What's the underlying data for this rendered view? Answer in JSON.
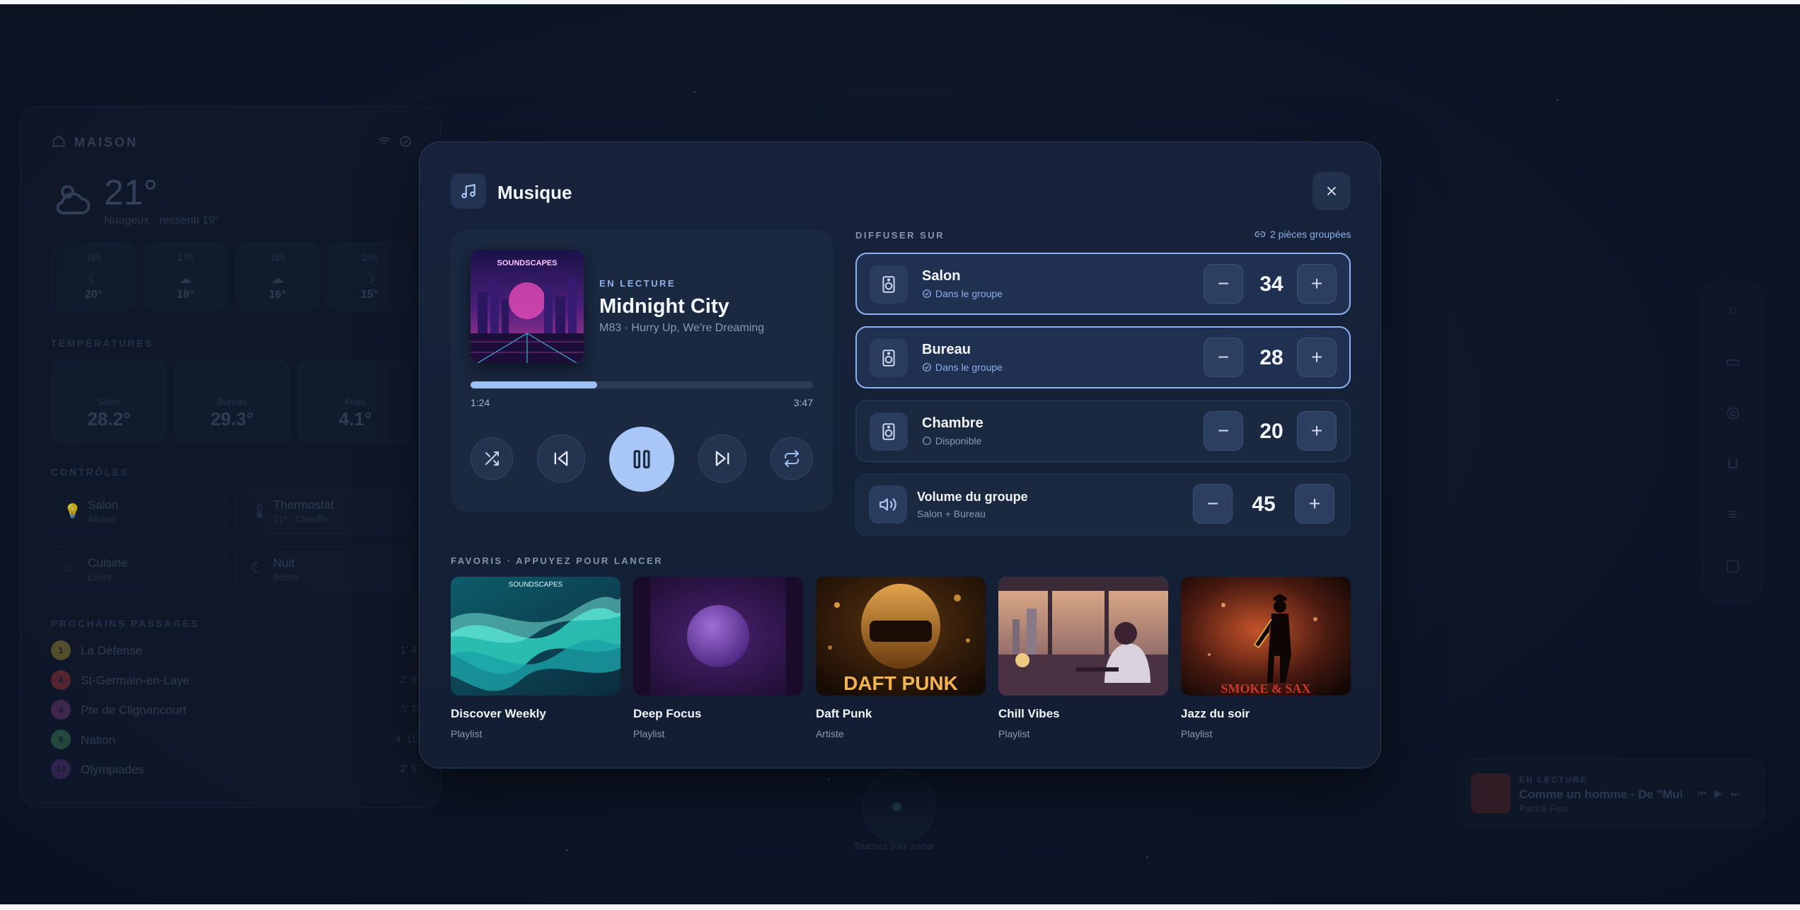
{
  "background": {
    "home_title": "MAISON",
    "temperature": "21°",
    "weather_sub": "Nuageux · ressenti 19°",
    "forecast": [
      {
        "hour": "16h",
        "temp": "20°"
      },
      {
        "hour": "17h",
        "temp": "18°"
      },
      {
        "hour": "18h",
        "temp": "16°"
      },
      {
        "hour": "19h",
        "temp": "15°"
      }
    ],
    "section_temperatures": "TEMPÉRATURES",
    "temperatures": [
      {
        "room": "Salon",
        "value": "28.2°"
      },
      {
        "room": "Bureau",
        "value": "29.3°"
      },
      {
        "room": "Frigo",
        "value": "4.1°"
      }
    ],
    "section_controls": "CONTRÔLES",
    "controls": [
      {
        "name": "Salon",
        "state": "Allumé"
      },
      {
        "name": "Thermostat",
        "state": "21° · Chauffe"
      },
      {
        "name": "Cuisine",
        "state": "Éteint"
      },
      {
        "name": "Nuit",
        "state": "Scène"
      }
    ],
    "section_transit": "PROCHAINS PASSAGES",
    "transit": [
      {
        "line": "1",
        "stop": "La Défense",
        "times": "1'  4'",
        "color": "#a89a3a"
      },
      {
        "line": "A",
        "stop": "St-Germain-en-Laye",
        "times": "2'  8'",
        "color": "#a8343f"
      },
      {
        "line": "4",
        "stop": "Pte de Clignancourt",
        "times": "3'  7'",
        "color": "#7a3a86"
      },
      {
        "line": "6",
        "stop": "Nation",
        "times": "4'  11'",
        "color": "#3f8a6a"
      },
      {
        "line": "14",
        "stop": "Olympiades",
        "times": "2'  5'",
        "color": "#5a3a8a"
      }
    ],
    "mini_player": {
      "label": "EN LECTURE",
      "title": "Comme un homme - De \"Mulan",
      "artist": "Patrick Fiori"
    },
    "tap_hint": "Touchez pour parler"
  },
  "modal": {
    "title": "Musique",
    "now_playing": {
      "label": "EN LECTURE",
      "title": "Midnight City",
      "subtitle": "M83 · Hurry Up, We're Dreaming",
      "album_art_text": "SOUNDSCAPES",
      "elapsed": "1:24",
      "duration": "3:47",
      "progress": 0.37
    },
    "cast": {
      "label": "DIFFUSER SUR",
      "group_info": "2 pièces groupées",
      "rooms": [
        {
          "name": "Salon",
          "status": "Dans le groupe",
          "volume": "34",
          "active": true
        },
        {
          "name": "Bureau",
          "status": "Dans le groupe",
          "volume": "28",
          "active": true
        },
        {
          "name": "Chambre",
          "status": "Disponible",
          "volume": "20",
          "active": false
        }
      ],
      "group_volume": {
        "label": "Volume du groupe",
        "rooms": "Salon + Bureau",
        "value": "45"
      }
    },
    "favorites": {
      "label": "FAVORIS · APPUYEZ POUR LANCER",
      "items": [
        {
          "name": "Discover Weekly",
          "type": "Playlist",
          "cover_text": "SOUNDSCAPES"
        },
        {
          "name": "Deep Focus",
          "type": "Playlist",
          "cover_text": ""
        },
        {
          "name": "Daft Punk",
          "type": "Artiste",
          "cover_text": "DAFT PUNK"
        },
        {
          "name": "Chill Vibes",
          "type": "Playlist",
          "cover_text": ""
        },
        {
          "name": "Jazz du soir",
          "type": "Playlist",
          "cover_text": "SMOKE & SAX"
        }
      ]
    }
  },
  "colors": {
    "accent": "#8eb2ef",
    "play": "#a8c6f6",
    "modal_bg": "#16233a"
  }
}
